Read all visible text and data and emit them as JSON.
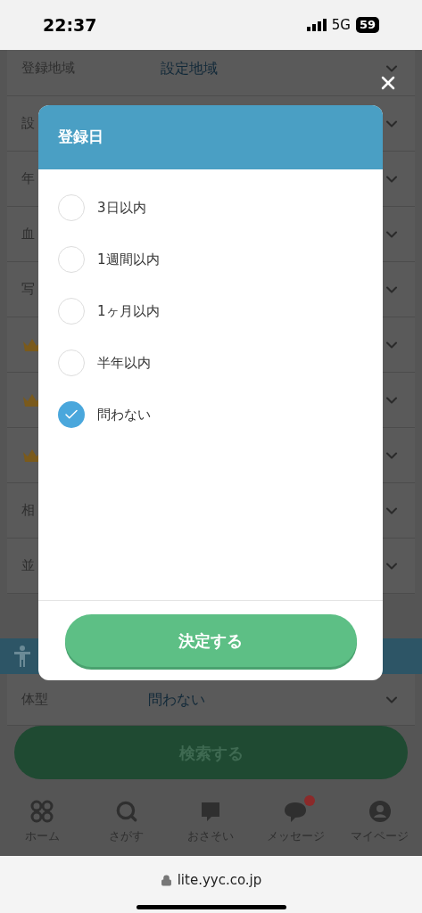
{
  "status_bar": {
    "time": "22:37",
    "network": "5G",
    "battery": "59"
  },
  "page": {
    "fields": [
      {
        "kind": "field",
        "label": "登録地域",
        "value": "設定地域"
      },
      {
        "kind": "field",
        "label": "設"
      },
      {
        "kind": "field",
        "label": "年"
      },
      {
        "kind": "field",
        "label": "血"
      },
      {
        "kind": "field",
        "label": "写"
      },
      {
        "kind": "premium"
      },
      {
        "kind": "premium"
      },
      {
        "kind": "premium"
      },
      {
        "kind": "field",
        "label": "相"
      },
      {
        "kind": "field",
        "label": "並"
      }
    ],
    "body_type": {
      "label": "体型",
      "value": "問わない"
    },
    "search_button": "検索する"
  },
  "modal": {
    "title": "登録日",
    "options": [
      {
        "label": "3日以内",
        "selected": false
      },
      {
        "label": "1週間以内",
        "selected": false
      },
      {
        "label": "1ヶ月以内",
        "selected": false
      },
      {
        "label": "半年以内",
        "selected": false
      },
      {
        "label": "問わない",
        "selected": true
      }
    ],
    "confirm_button": "決定する"
  },
  "tab_bar": [
    {
      "kind": "home",
      "label": "ホーム",
      "badge": false
    },
    {
      "kind": "search",
      "label": "さがす",
      "badge": false
    },
    {
      "kind": "invite",
      "label": "おさそい",
      "badge": false
    },
    {
      "kind": "message",
      "label": "メッセージ",
      "badge": true
    },
    {
      "kind": "mypage",
      "label": "マイページ",
      "badge": false
    }
  ],
  "browser": {
    "url": "lite.yyc.co.jp"
  }
}
